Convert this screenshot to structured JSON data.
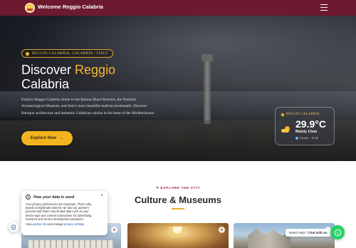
{
  "header": {
    "site_title": "Welcome Reggio Calabria",
    "logo_icon": "city-crest-icon",
    "menu_icon": "hamburger-menu-icon"
  },
  "hero": {
    "location_badge": "REGGIO CALABRIA, CALABRIA - ITALY",
    "title_line1": "Discover",
    "title_accent": "Reggio",
    "title_line2": "Calabria",
    "description": "Explore Reggio Calabria: home to the famous Riace Bronzes, the National Archaeological Museum, and Italy's most beautiful seafront promenade. Discover Baroque architecture and authentic Calabrian cuisine in the heart of the Mediterranean.",
    "cta_label": "Explore Now",
    "cta_arrow": "→"
  },
  "weather": {
    "place": "REGGIO CALABRIA",
    "temperature": "29.9°C",
    "condition": "Mainly Clear",
    "wind": "9 km/h · 15:00",
    "icon": "partly-cloudy-icon"
  },
  "section": {
    "kicker": "EXPLORE THE CITY",
    "title": "Culture & Museums"
  },
  "privacy": {
    "title": "How your data is used",
    "body": "Your privacy preferences are important. That's why, based on legitimate interest, we and our partners process and share only limited data such as your device type and content interactions for advertising, research and service development purposes.",
    "foot_prefix": "View ",
    "partner_link": "partner list",
    "foot_mid": " and manage ",
    "settings_link": "privacy settings",
    "foot_suffix": ".",
    "close": "×"
  },
  "chat": {
    "prefix": "Need Help?",
    "label": "Chat with us"
  },
  "colors": {
    "brand_maroon": "#6d1a30",
    "accent_gold": "#f4b41f",
    "whatsapp_green": "#25d366"
  }
}
